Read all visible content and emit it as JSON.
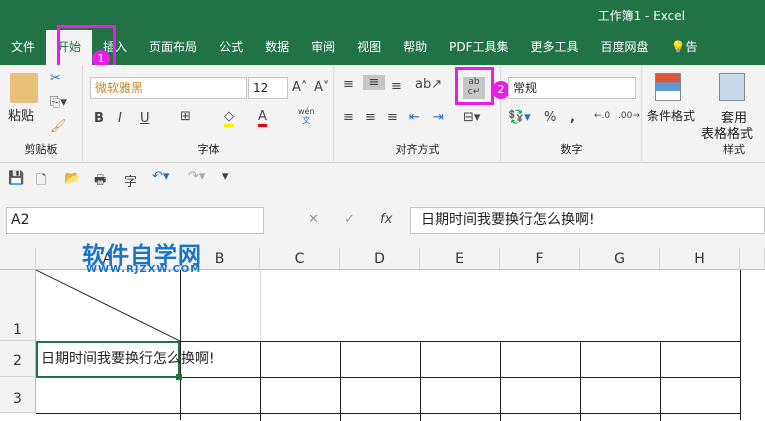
{
  "window": {
    "title": "工作簿1  -  Excel"
  },
  "tabs": [
    "文件",
    "开始",
    "插入",
    "页面布局",
    "公式",
    "数据",
    "审阅",
    "视图",
    "帮助",
    "PDF工具集",
    "更多工具",
    "百度网盘",
    "告"
  ],
  "ribbon": {
    "clipboard": {
      "paste": "粘贴",
      "label": "剪贴板"
    },
    "font": {
      "name": "微软雅黑",
      "size": "12",
      "label": "字体",
      "bold": "B",
      "italic": "I",
      "underline": "U",
      "phonetic_top": "wén",
      "phonetic_bottom": "文"
    },
    "alignment": {
      "label": "对齐方式",
      "wrap": "ab\nc"
    },
    "number": {
      "format": "常规",
      "label": "数字",
      "percent": "%",
      "comma": ","
    },
    "styles": {
      "conditional": "条件格式",
      "table1": "套用",
      "table2": "表格格式",
      "label": "样式"
    }
  },
  "badges": [
    "1",
    "2"
  ],
  "formula_bar": {
    "name_box": "A2",
    "fx": "fx",
    "cancel": "✕",
    "enter": "✓",
    "value": "日期时间我要换行怎么换啊!"
  },
  "watermark": {
    "title": "软件自学网",
    "url": "WWW.RJZXW.COM"
  },
  "columns": [
    "A",
    "B",
    "C",
    "D",
    "E",
    "F",
    "G",
    "H"
  ],
  "rows": [
    "1",
    "2",
    "3"
  ],
  "cells": {
    "A2": "日期时间我要换行怎么换啊!"
  },
  "colors": {
    "accent": "#217346",
    "highlight": "#e81ee8"
  }
}
